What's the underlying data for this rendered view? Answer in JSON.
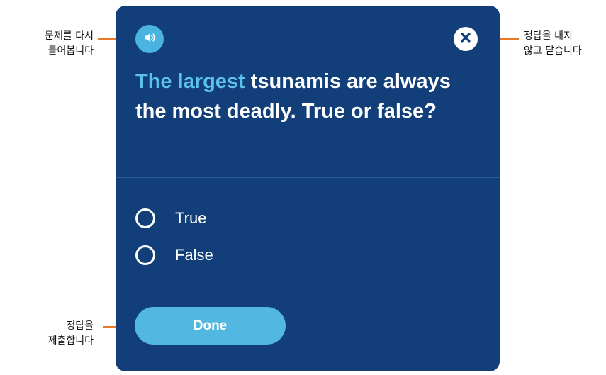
{
  "quiz": {
    "question_highlight": "The largest",
    "question_rest": " tsunamis are always the most deadly. True or false?",
    "options": [
      {
        "label": "True"
      },
      {
        "label": "False"
      }
    ],
    "done_label": "Done",
    "icons": {
      "speaker": "speaker-icon",
      "close": "close-icon"
    },
    "colors": {
      "panel_background": "#123f7a",
      "accent": "#4ab3df",
      "highlight_text": "#5cc2ea",
      "callout_line": "#e9782a"
    }
  },
  "callouts": {
    "replay": {
      "line1": "문제를 다시",
      "line2": "들어봅니다"
    },
    "close": {
      "line1": "정답을 내지",
      "line2": "않고 닫습니다"
    },
    "submit": {
      "line1": "정답을",
      "line2": "제출합니다"
    }
  }
}
